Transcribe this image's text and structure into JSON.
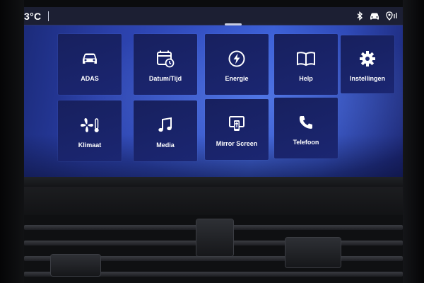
{
  "status_bar": {
    "temperature": "3°C",
    "icons": [
      "bluetooth-icon",
      "car-icon",
      "location-icon"
    ]
  },
  "tiles": [
    {
      "label": "ADAS",
      "icon": "car-icon"
    },
    {
      "label": "Datum/Tijd",
      "icon": "calendar-clock-icon"
    },
    {
      "label": "Energie",
      "icon": "lightning-icon"
    },
    {
      "label": "Help",
      "icon": "book-icon"
    },
    {
      "label": "Instellingen",
      "icon": "gear-icon"
    },
    {
      "label": "Klimaat",
      "icon": "fan-temperature-icon"
    },
    {
      "label": "Media",
      "icon": "music-note-icon"
    },
    {
      "label": "Mirror Screen",
      "icon": "mirror-screen-icon"
    },
    {
      "label": "Telefoon",
      "icon": "phone-icon"
    }
  ],
  "colors": {
    "screen_blue": "#3350c4",
    "tile_navy": "#17205e",
    "text": "#ffffff"
  }
}
